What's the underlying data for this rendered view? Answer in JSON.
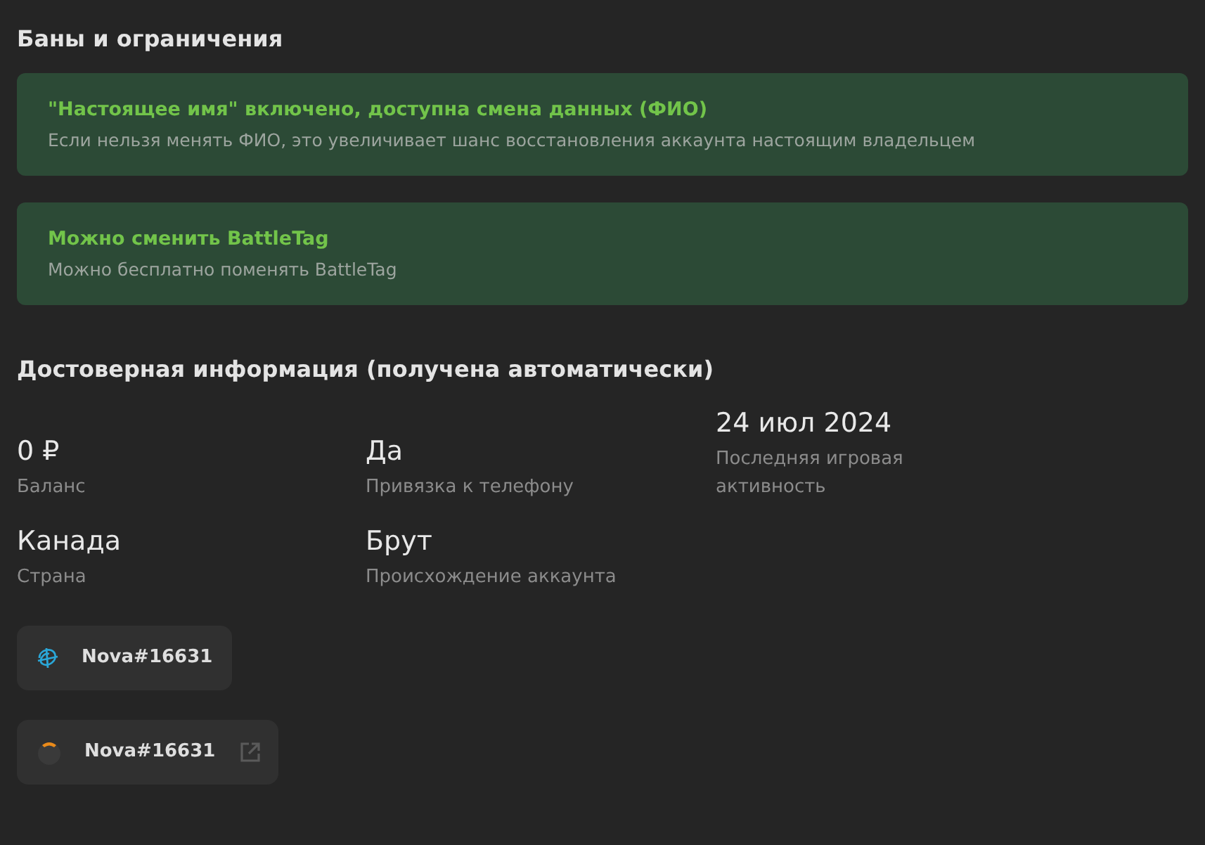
{
  "bans_section": {
    "title": "Баны и ограничения",
    "notices": [
      {
        "title": "\"Настоящее имя\" включено, доступна смена данных (ФИО)",
        "description": "Если нельзя менять ФИО, это увеличивает шанс восстановления аккаунта настоящим владельцем"
      },
      {
        "title": "Можно сменить BattleTag",
        "description": "Можно бесплатно поменять BattleTag"
      }
    ]
  },
  "info_section": {
    "title": "Достоверная информация (получена автоматически)",
    "facts": [
      {
        "value": "0 ₽",
        "label": "Баланс"
      },
      {
        "value": "Да",
        "label": "Привязка к телефону"
      },
      {
        "value": "24 июл 2024",
        "label": "Последняя игровая активность"
      },
      {
        "value": "Канада",
        "label": "Страна"
      },
      {
        "value": "Брут",
        "label": "Происхождение аккаунта"
      }
    ]
  },
  "accounts": [
    {
      "kind": "battlenet",
      "name": "Nova#16631",
      "external_link": false
    },
    {
      "kind": "overwatch",
      "name": "Nova#16631",
      "external_link": true
    }
  ]
}
